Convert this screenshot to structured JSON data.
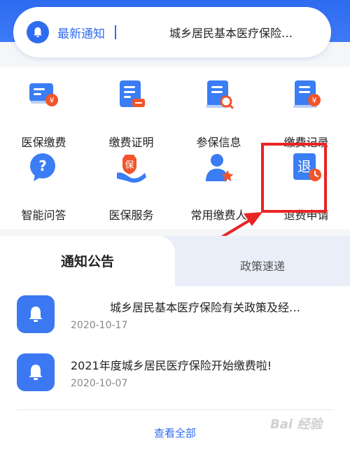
{
  "notice": {
    "title": "最新通知",
    "text": "城乡居民基本医疗保险…"
  },
  "services": [
    {
      "label": "医保缴费",
      "icon": "card-yuan-icon"
    },
    {
      "label": "缴费证明",
      "icon": "document-card-icon"
    },
    {
      "label": "参保信息",
      "icon": "document-search-icon"
    },
    {
      "label": "缴费记录",
      "icon": "document-yuan-icon"
    },
    {
      "label": "智能问答",
      "icon": "question-bubble-icon"
    },
    {
      "label": "医保服务",
      "icon": "hand-shield-icon"
    },
    {
      "label": "常用缴费人",
      "icon": "person-star-icon"
    },
    {
      "label": "退费申请",
      "icon": "refund-clock-icon",
      "glyph": "退"
    }
  ],
  "tabs": {
    "active": "通知公告",
    "inactive": "政策速递"
  },
  "news": [
    {
      "title": "城乡居民基本医疗保险有关政策及经…",
      "date": "2020-10-17"
    },
    {
      "title": "2021年度城乡居民医疗保险开始缴费啦!",
      "date": "2020-10-07"
    }
  ],
  "view_all": "查看全部",
  "watermark": "Bai 经验",
  "colors": {
    "accent": "#2f6cf0",
    "highlight": "#e82424",
    "badge": "#f0542b"
  }
}
